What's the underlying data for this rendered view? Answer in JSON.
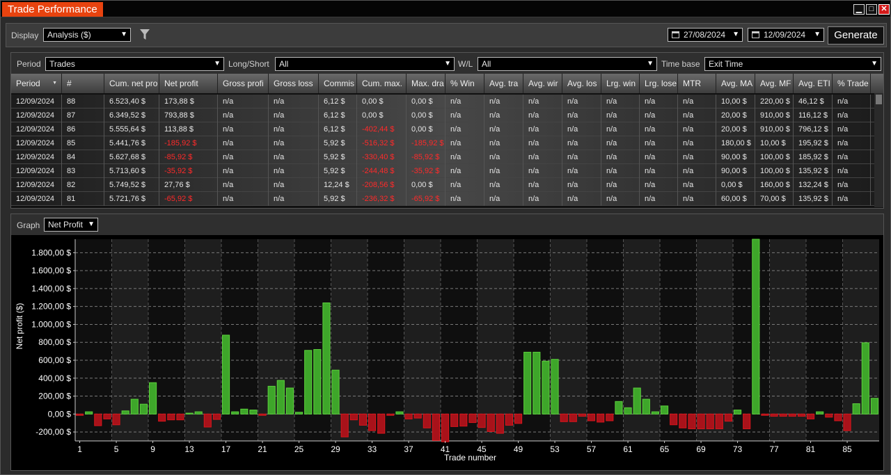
{
  "window": {
    "title": "Trade Performance",
    "min": "▁",
    "max": "□",
    "close": "✕"
  },
  "toolbar": {
    "display_label": "Display",
    "display_value": "Analysis ($)",
    "date_from": "27/08/2024",
    "date_to": "12/09/2024",
    "generate": "Generate"
  },
  "filters": {
    "period_label": "Period",
    "period_value": "Trades",
    "longshort_label": "Long/Short",
    "longshort_value": "All",
    "wl_label": "W/L",
    "wl_value": "All",
    "timebase_label": "Time base",
    "timebase_value": "Exit Time"
  },
  "columns": [
    "Period",
    "#",
    "Cum. net pro",
    "Net profit",
    "Gross profi",
    "Gross loss",
    "Commis",
    "Cum. max.",
    "Max. dra",
    "% Win",
    "Avg. tra",
    "Avg. wir",
    "Avg. los",
    "Lrg. win",
    "Lrg. lose",
    "MTR",
    "Avg. MA",
    "Avg. MF",
    "Avg. ETI",
    "% Trade"
  ],
  "rows": [
    {
      "cells": [
        "12/09/2024",
        "88",
        "6.523,40 $",
        "173,88 $",
        "n/a",
        "n/a",
        "6,12 $",
        "0,00 $",
        "0,00 $",
        "n/a",
        "n/a",
        "n/a",
        "n/a",
        "n/a",
        "n/a",
        "n/a",
        "10,00 $",
        "220,00 $",
        "46,12 $",
        "n/a"
      ],
      "neg": []
    },
    {
      "cells": [
        "12/09/2024",
        "87",
        "6.349,52 $",
        "793,88 $",
        "n/a",
        "n/a",
        "6,12 $",
        "0,00 $",
        "0,00 $",
        "n/a",
        "n/a",
        "n/a",
        "n/a",
        "n/a",
        "n/a",
        "n/a",
        "20,00 $",
        "910,00 $",
        "116,12 $",
        "n/a"
      ],
      "neg": []
    },
    {
      "cells": [
        "12/09/2024",
        "86",
        "5.555,64 $",
        "113,88 $",
        "n/a",
        "n/a",
        "6,12 $",
        "-402,44 $",
        "0,00 $",
        "n/a",
        "n/a",
        "n/a",
        "n/a",
        "n/a",
        "n/a",
        "n/a",
        "20,00 $",
        "910,00 $",
        "796,12 $",
        "n/a"
      ],
      "neg": [
        7
      ]
    },
    {
      "cells": [
        "12/09/2024",
        "85",
        "5.441,76 $",
        "-185,92 $",
        "n/a",
        "n/a",
        "5,92 $",
        "-516,32 $",
        "-185,92 $",
        "n/a",
        "n/a",
        "n/a",
        "n/a",
        "n/a",
        "n/a",
        "n/a",
        "180,00 $",
        "10,00 $",
        "195,92 $",
        "n/a"
      ],
      "neg": [
        3,
        7,
        8
      ]
    },
    {
      "cells": [
        "12/09/2024",
        "84",
        "5.627,68 $",
        "-85,92 $",
        "n/a",
        "n/a",
        "5,92 $",
        "-330,40 $",
        "-85,92 $",
        "n/a",
        "n/a",
        "n/a",
        "n/a",
        "n/a",
        "n/a",
        "n/a",
        "90,00 $",
        "100,00 $",
        "185,92 $",
        "n/a"
      ],
      "neg": [
        3,
        7,
        8
      ]
    },
    {
      "cells": [
        "12/09/2024",
        "83",
        "5.713,60 $",
        "-35,92 $",
        "n/a",
        "n/a",
        "5,92 $",
        "-244,48 $",
        "-35,92 $",
        "n/a",
        "n/a",
        "n/a",
        "n/a",
        "n/a",
        "n/a",
        "n/a",
        "90,00 $",
        "100,00 $",
        "135,92 $",
        "n/a"
      ],
      "neg": [
        3,
        7,
        8
      ]
    },
    {
      "cells": [
        "12/09/2024",
        "82",
        "5.749,52 $",
        "27,76 $",
        "n/a",
        "n/a",
        "12,24 $",
        "-208,56 $",
        "0,00 $",
        "n/a",
        "n/a",
        "n/a",
        "n/a",
        "n/a",
        "n/a",
        "n/a",
        "0,00 $",
        "160,00 $",
        "132,24 $",
        "n/a"
      ],
      "neg": [
        7
      ]
    },
    {
      "cells": [
        "12/09/2024",
        "81",
        "5.721,76 $",
        "-65,92 $",
        "n/a",
        "n/a",
        "5,92 $",
        "-236,32 $",
        "-65,92 $",
        "n/a",
        "n/a",
        "n/a",
        "n/a",
        "n/a",
        "n/a",
        "n/a",
        "60,00 $",
        "70,00 $",
        "135,92 $",
        "n/a"
      ],
      "neg": [
        3,
        7,
        8
      ]
    }
  ],
  "graph": {
    "label": "Graph",
    "value": "Net Profit"
  },
  "chart_data": {
    "type": "bar",
    "xlabel": "Trade number",
    "ylabel": "Net profit ($)",
    "ylim": [
      -300,
      1950
    ],
    "yticks": [
      -200,
      0,
      200,
      400,
      600,
      800,
      1000,
      1200,
      1400,
      1600,
      1800
    ],
    "ytick_labels": [
      "-200,00 $",
      "0,00 $",
      "200,00 $",
      "400,00 $",
      "600,00 $",
      "800,00 $",
      "1.000,00 $",
      "1.200,00 $",
      "1.400,00 $",
      "1.600,00 $",
      "1.800,00 $"
    ],
    "xtick_labels": [
      "1",
      "5",
      "9",
      "13",
      "17",
      "21",
      "25",
      "29",
      "33",
      "37",
      "41",
      "45",
      "49",
      "53",
      "57",
      "61",
      "65",
      "69",
      "73",
      "77",
      "81",
      "85"
    ],
    "x": [
      1,
      2,
      3,
      4,
      5,
      6,
      7,
      8,
      9,
      10,
      11,
      12,
      13,
      14,
      15,
      16,
      17,
      18,
      19,
      20,
      21,
      22,
      23,
      24,
      25,
      26,
      27,
      28,
      29,
      30,
      31,
      32,
      33,
      34,
      35,
      36,
      37,
      38,
      39,
      40,
      41,
      42,
      43,
      44,
      45,
      46,
      47,
      48,
      49,
      50,
      51,
      52,
      53,
      54,
      55,
      56,
      57,
      58,
      59,
      60,
      61,
      62,
      63,
      64,
      65,
      66,
      67,
      68,
      69,
      70,
      71,
      72,
      73,
      74,
      75,
      76,
      77,
      78,
      79,
      80,
      81,
      82,
      83,
      84,
      85,
      86,
      87,
      88
    ],
    "values": [
      -15,
      25,
      -130,
      -55,
      -120,
      35,
      165,
      110,
      350,
      -80,
      -65,
      -65,
      10,
      25,
      -145,
      -60,
      880,
      25,
      55,
      45,
      -15,
      310,
      375,
      290,
      20,
      710,
      720,
      1240,
      490,
      -255,
      -65,
      -125,
      -185,
      -215,
      -15,
      25,
      -55,
      -45,
      -155,
      -295,
      -310,
      -140,
      -135,
      -95,
      -150,
      -195,
      -215,
      -125,
      -105,
      690,
      690,
      590,
      610,
      -85,
      -85,
      -25,
      -75,
      -90,
      -75,
      140,
      70,
      290,
      165,
      25,
      90,
      -120,
      -155,
      -165,
      -165,
      -165,
      -165,
      -80,
      45,
      -165,
      1950,
      -15,
      -25,
      -25,
      -25,
      -25,
      -55,
      25,
      -35,
      -75,
      -185,
      115,
      795,
      175
    ],
    "colors": {
      "positive": "#5cd13c",
      "negative": "#d8161c",
      "grid": "#7a7a7a"
    }
  }
}
